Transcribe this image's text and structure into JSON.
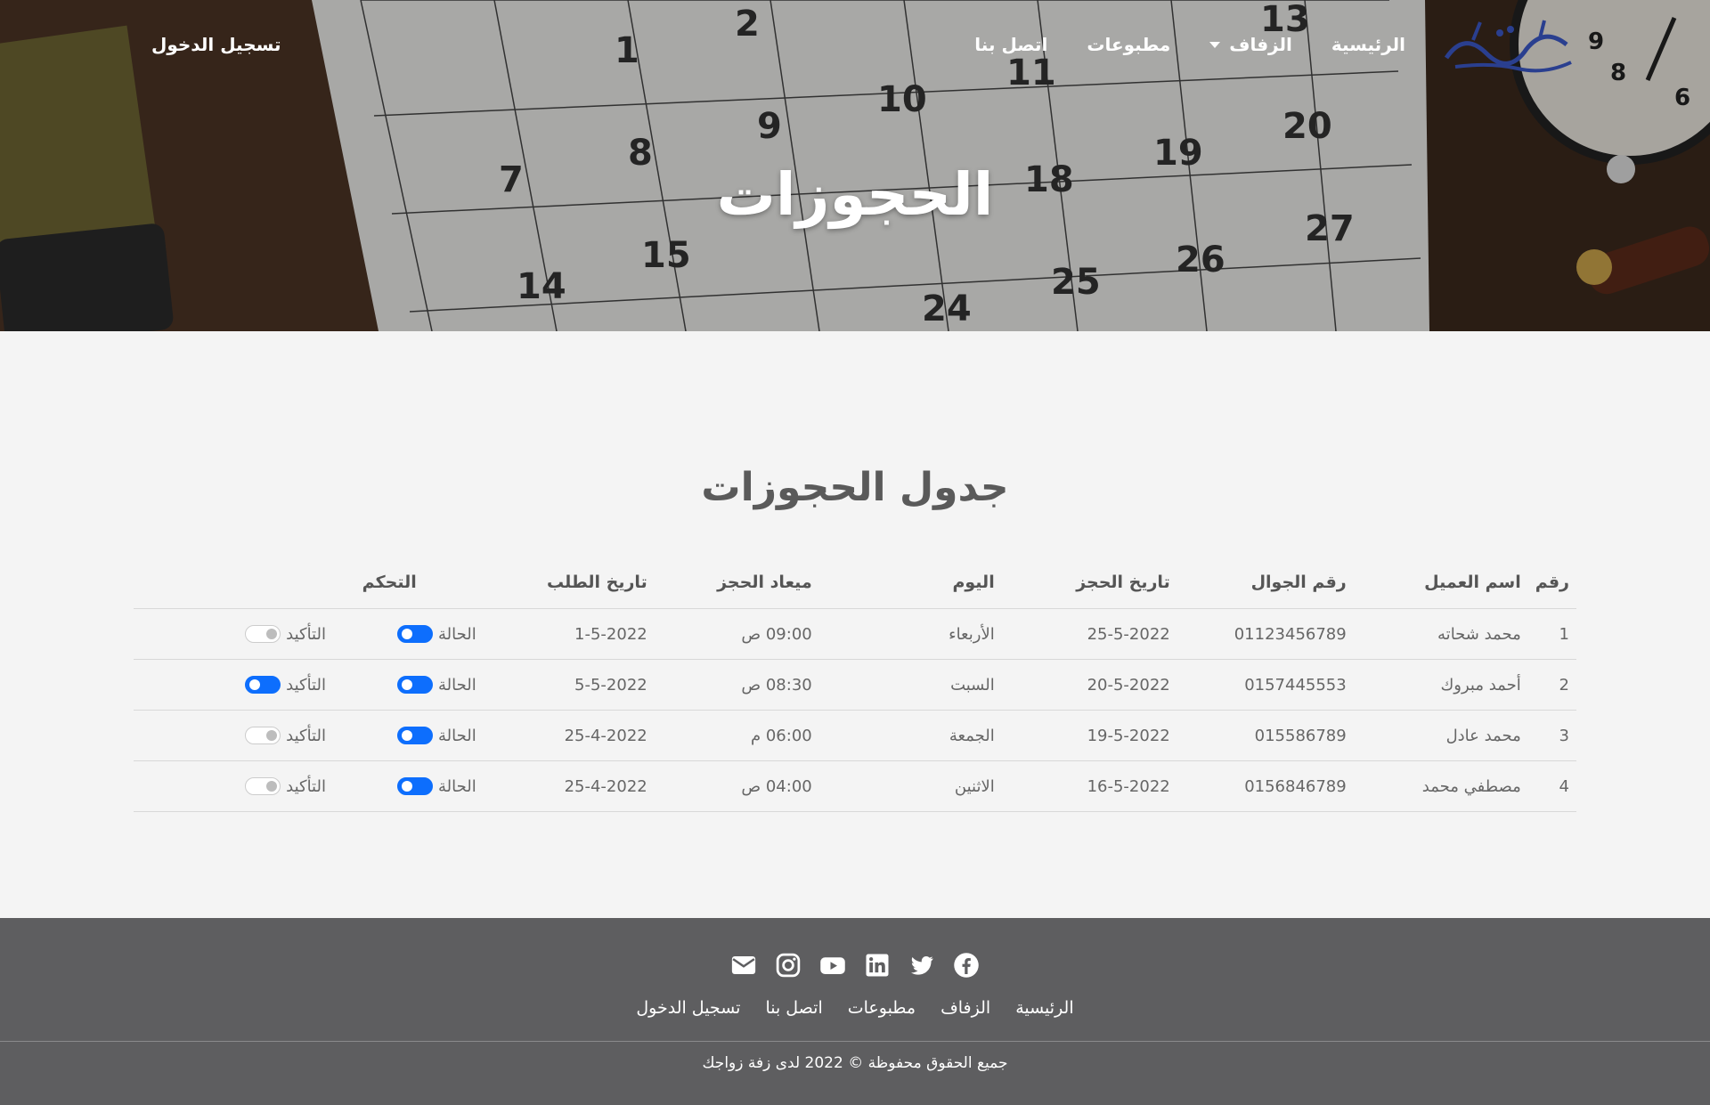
{
  "nav": {
    "home": "الرئيسية",
    "wedding": "الزفاف",
    "prints": "مطبوعات",
    "contact": "اتصل بنا",
    "login": "تسجيل الدخول"
  },
  "hero": {
    "title": "الحجوزات"
  },
  "section": {
    "title": "جدول الحجوزات"
  },
  "table": {
    "headers": [
      "رقم",
      "اسم العميل",
      "رقم الجوال",
      "تاريخ الحجز",
      "اليوم",
      "ميعاد الحجز",
      "تاريخ الطلب",
      "التحكم"
    ],
    "status_label": "الحالة",
    "confirm_label": "التأكيد",
    "rows": [
      {
        "num": "1",
        "name": "محمد شحاته",
        "phone": "01123456789",
        "date": "25-5-2022",
        "day": "الأربعاء",
        "time": "09:00 ص",
        "order": "1-5-2022",
        "status_on": true,
        "confirm_on": false
      },
      {
        "num": "2",
        "name": "أحمد مبروك",
        "phone": "0157445553",
        "date": "20-5-2022",
        "day": "السبت",
        "time": "08:30 ص",
        "order": "5-5-2022",
        "status_on": true,
        "confirm_on": true
      },
      {
        "num": "3",
        "name": "محمد عادل",
        "phone": "015586789",
        "date": "19-5-2022",
        "day": "الجمعة",
        "time": "06:00 م",
        "order": "25-4-2022",
        "status_on": true,
        "confirm_on": false
      },
      {
        "num": "4",
        "name": "مصطفي محمد",
        "phone": "0156846789",
        "date": "16-5-2022",
        "day": "الاثنين",
        "time": "04:00 ص",
        "order": "25-4-2022",
        "status_on": true,
        "confirm_on": false
      }
    ]
  },
  "footer": {
    "social": [
      "facebook-icon",
      "twitter-icon",
      "linkedin-icon",
      "youtube-icon",
      "instagram-icon",
      "envelope-icon"
    ],
    "links": {
      "home": "الرئيسية",
      "wedding": "الزفاف",
      "prints": "مطبوعات",
      "contact": "اتصل بنا",
      "login": "تسجيل الدخول"
    },
    "copyright": "جميع الحقوق محفوظة © 2022 لدى زفة زواجك"
  },
  "logo": {
    "text": "زفة زواجك"
  },
  "colors": {
    "accent": "#0d6efd",
    "footer_bg": "#5e5e60",
    "page_bg": "#f4f4f4"
  }
}
